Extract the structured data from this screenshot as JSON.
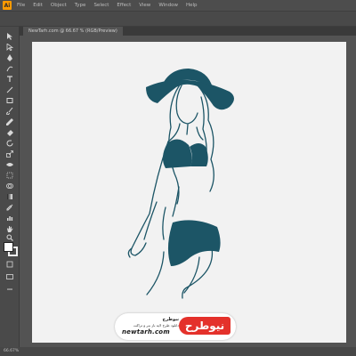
{
  "app": {
    "logo_text": "Ai"
  },
  "menubar": {
    "items": [
      "File",
      "Edit",
      "Object",
      "Type",
      "Select",
      "Effect",
      "View",
      "Window",
      "Help"
    ]
  },
  "document": {
    "tab_label": "NewTarh.com @ 66.67 % (RGB/Preview)"
  },
  "status": {
    "zoom": "66.67%"
  },
  "tools": [
    "selection-tool",
    "direct-selection-tool",
    "pen-tool",
    "curvature-tool",
    "type-tool",
    "line-tool",
    "rectangle-tool",
    "paintbrush-tool",
    "pencil-tool",
    "eraser-tool",
    "rotate-tool",
    "scale-tool",
    "width-tool",
    "free-transform-tool",
    "shape-builder-tool",
    "perspective-tool",
    "mesh-tool",
    "gradient-tool",
    "eyedropper-tool",
    "blend-tool",
    "symbol-sprayer-tool",
    "graph-tool",
    "artboard-tool",
    "slice-tool",
    "hand-tool",
    "zoom-tool"
  ],
  "artwork": {
    "subject": "woman-in-sun-hat-illustration",
    "color": "#1c5566"
  },
  "watermark": {
    "logo": "نیوطرح",
    "title": "نیوطرح",
    "subtitle": "دانلود طرح لایه باز بنر و تراکت",
    "url": "newtarh.com"
  }
}
